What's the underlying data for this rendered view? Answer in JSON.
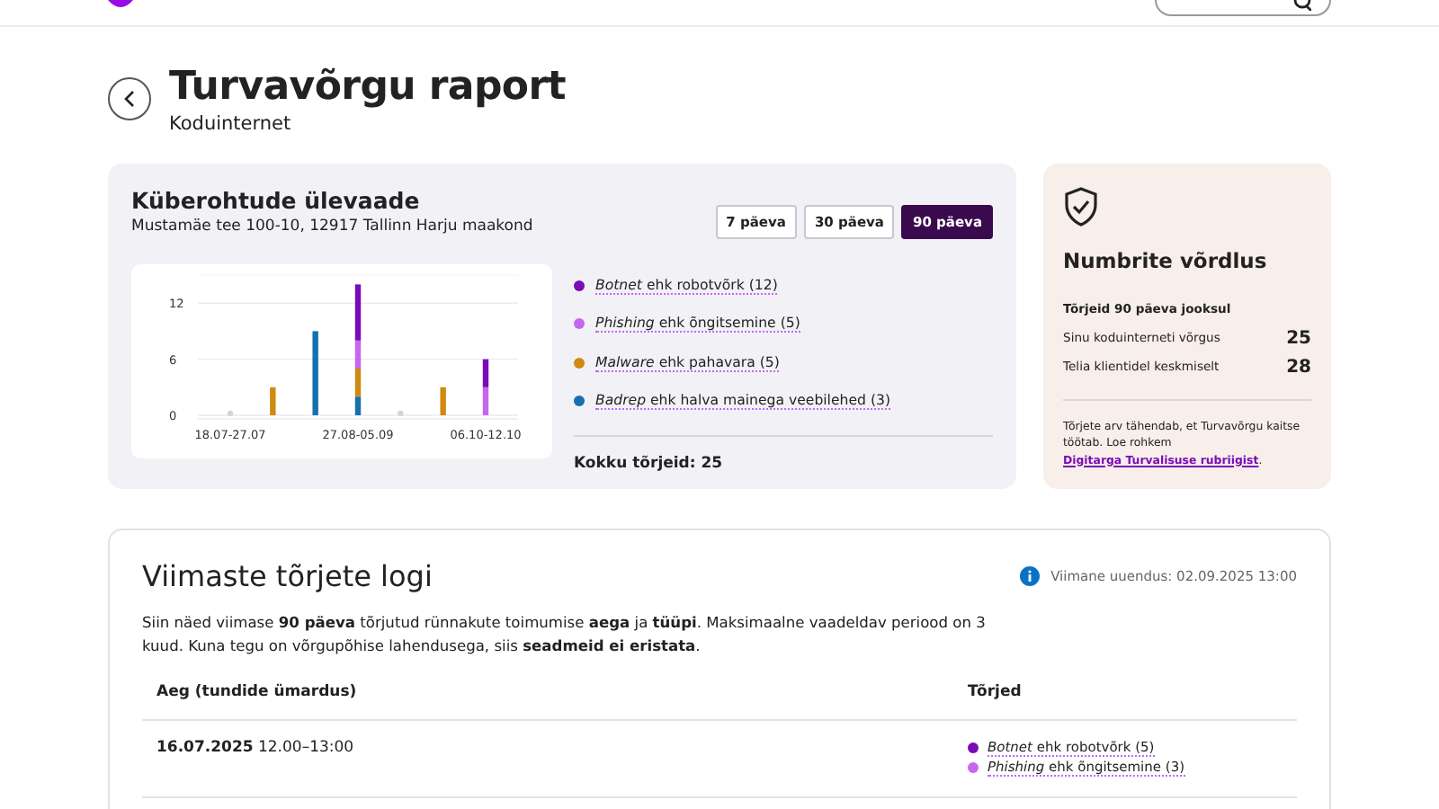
{
  "page": {
    "title": "Turvavõrgu raport",
    "subtitle": "Koduinternet"
  },
  "overview": {
    "title": "Küberohtude ülevaade",
    "address": "Mustamäe tee 100-10, 12917 Tallinn Harju maakond",
    "periods": [
      {
        "label": "7 päeva",
        "selected": false
      },
      {
        "label": "30 päeva",
        "selected": false
      },
      {
        "label": "90 päeva",
        "selected": true
      }
    ],
    "legend": [
      {
        "name": "*Botnet* ehk robotvõrk",
        "count": "(12)",
        "color": "#7a0bb8"
      },
      {
        "name": "*Phishing* ehk õngitsemine",
        "count": "(5)",
        "color": "#c667f0"
      },
      {
        "name": "*Malware* ehk pahavara",
        "count": "(5)",
        "color": "#d08a10"
      },
      {
        "name": "*Badrep* ehk halva mainega veebilehed",
        "count": "(3)",
        "color": "#1570b0"
      }
    ],
    "total": "Kokku tõrjeid: 25",
    "chart_data": {
      "type": "bar",
      "stacked": true,
      "categories": [
        "18.07-27.07",
        null,
        null,
        "27.08-05.09",
        null,
        null,
        "06.10-12.10"
      ],
      "ylim": [
        0,
        15
      ],
      "yticks": [
        0,
        6,
        12
      ],
      "series": [
        {
          "color": "#1570b0",
          "values": [
            0,
            0,
            9,
            2,
            0,
            0,
            0
          ]
        },
        {
          "color": "#d08a10",
          "values": [
            0,
            3,
            0,
            3,
            0,
            3,
            0
          ]
        },
        {
          "color": "#c667f0",
          "values": [
            0,
            0,
            0,
            3,
            0,
            0,
            3
          ]
        },
        {
          "color": "#7a0bb8",
          "values": [
            0,
            0,
            0,
            6,
            0,
            0,
            3
          ]
        }
      ]
    }
  },
  "comparison": {
    "title": "Numbrite võrdlus",
    "subtitle": "Tõrjeid 90 päeva jooksul",
    "rows": [
      {
        "label": "Sinu koduinterneti võrgus",
        "value": "25"
      },
      {
        "label": "Telia klientidel keskmiselt",
        "value": "28"
      }
    ],
    "note": "Tõrjete arv tähendab, et Turvavõrgu kaitse töötab. Loe rohkem",
    "link": "Digitarga Turvalisuse rubriigist",
    "note_end": "."
  },
  "log": {
    "title": "Viimaste tõrjete logi",
    "updated": "Viimane uuendus: 02.09.2025 13:00",
    "description": "Siin näed viimase **90 päeva** tõrjutud rünnakute toimumise **aega** ja **tüüpi**. Maksimaalne vaadeldav periood on 3 kuud. Kuna tegu on võrgupõhise lahendusega, siis **seadmeid ei eristata**.",
    "columns": [
      "Aeg (tundide ümardus)",
      "Tõrjed"
    ],
    "rows": [
      {
        "date": "16.07.2025",
        "time": "12.00–13:00",
        "items": [
          {
            "name": "*Botnet* ehk robotvõrk (5)",
            "color": "#7a0bb8"
          },
          {
            "name": "*Phishing* ehk õngitsemine (3)",
            "color": "#c667f0"
          }
        ]
      }
    ]
  }
}
